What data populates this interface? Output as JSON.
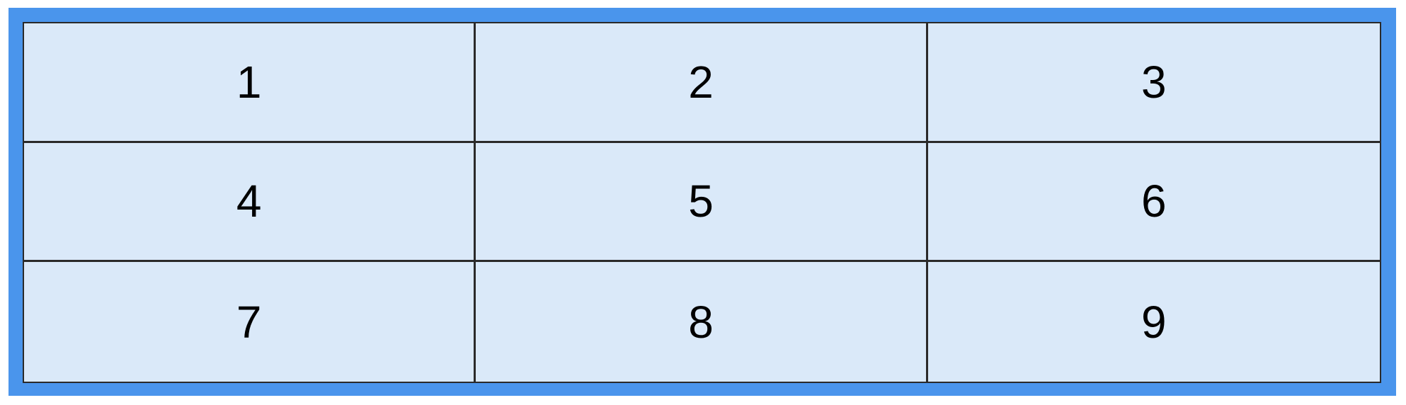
{
  "grid": {
    "cells": [
      "1",
      "2",
      "3",
      "4",
      "5",
      "6",
      "7",
      "8",
      "9"
    ]
  },
  "colors": {
    "frame": "#4a95ec",
    "cell_background": "#dae9f9",
    "grid_line": "#2a2a2a",
    "text": "#000000"
  }
}
